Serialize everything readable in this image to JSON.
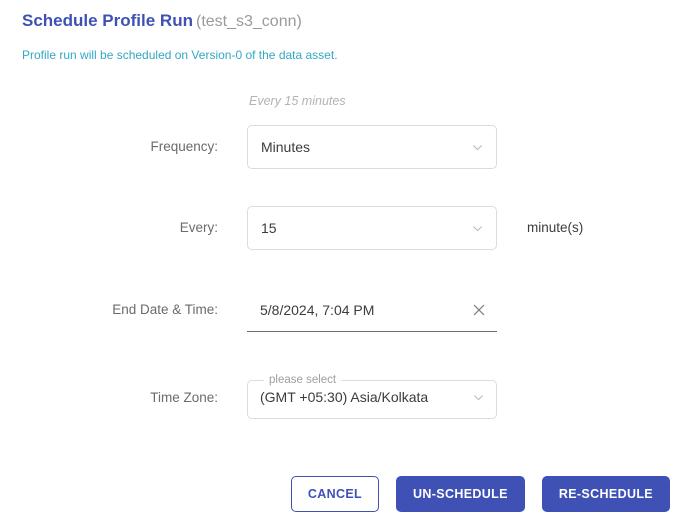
{
  "header": {
    "title": "Schedule Profile Run",
    "connection": "(test_s3_conn)",
    "subtitle": "Profile run will be scheduled on Version-0 of the data asset."
  },
  "form": {
    "summary_hint": "Every 15 minutes",
    "frequency": {
      "label": "Frequency:",
      "value": "Minutes",
      "dropdown_icon": "chevron-down-icon"
    },
    "every": {
      "label": "Every:",
      "value": "15",
      "suffix": "minute(s)",
      "dropdown_icon": "chevron-down-icon"
    },
    "end_date_time": {
      "label": "End Date & Time:",
      "value": "5/8/2024, 7:04 PM",
      "clear_icon": "close-icon"
    },
    "time_zone": {
      "label": "Time Zone:",
      "legend": "please select",
      "value": "(GMT +05:30) Asia/Kolkata",
      "dropdown_icon": "chevron-down-icon"
    }
  },
  "footer": {
    "cancel_label": "CANCEL",
    "unschedule_label": "UN-SCHEDULE",
    "reschedule_label": "RE-SCHEDULE"
  },
  "colors": {
    "accent": "#3f51b5",
    "subtitle": "#32a8c4",
    "label": "#6b6b6b",
    "hint": "#b3b3b3",
    "border": "#dcdcdc",
    "underline": "#6e6e6e"
  }
}
